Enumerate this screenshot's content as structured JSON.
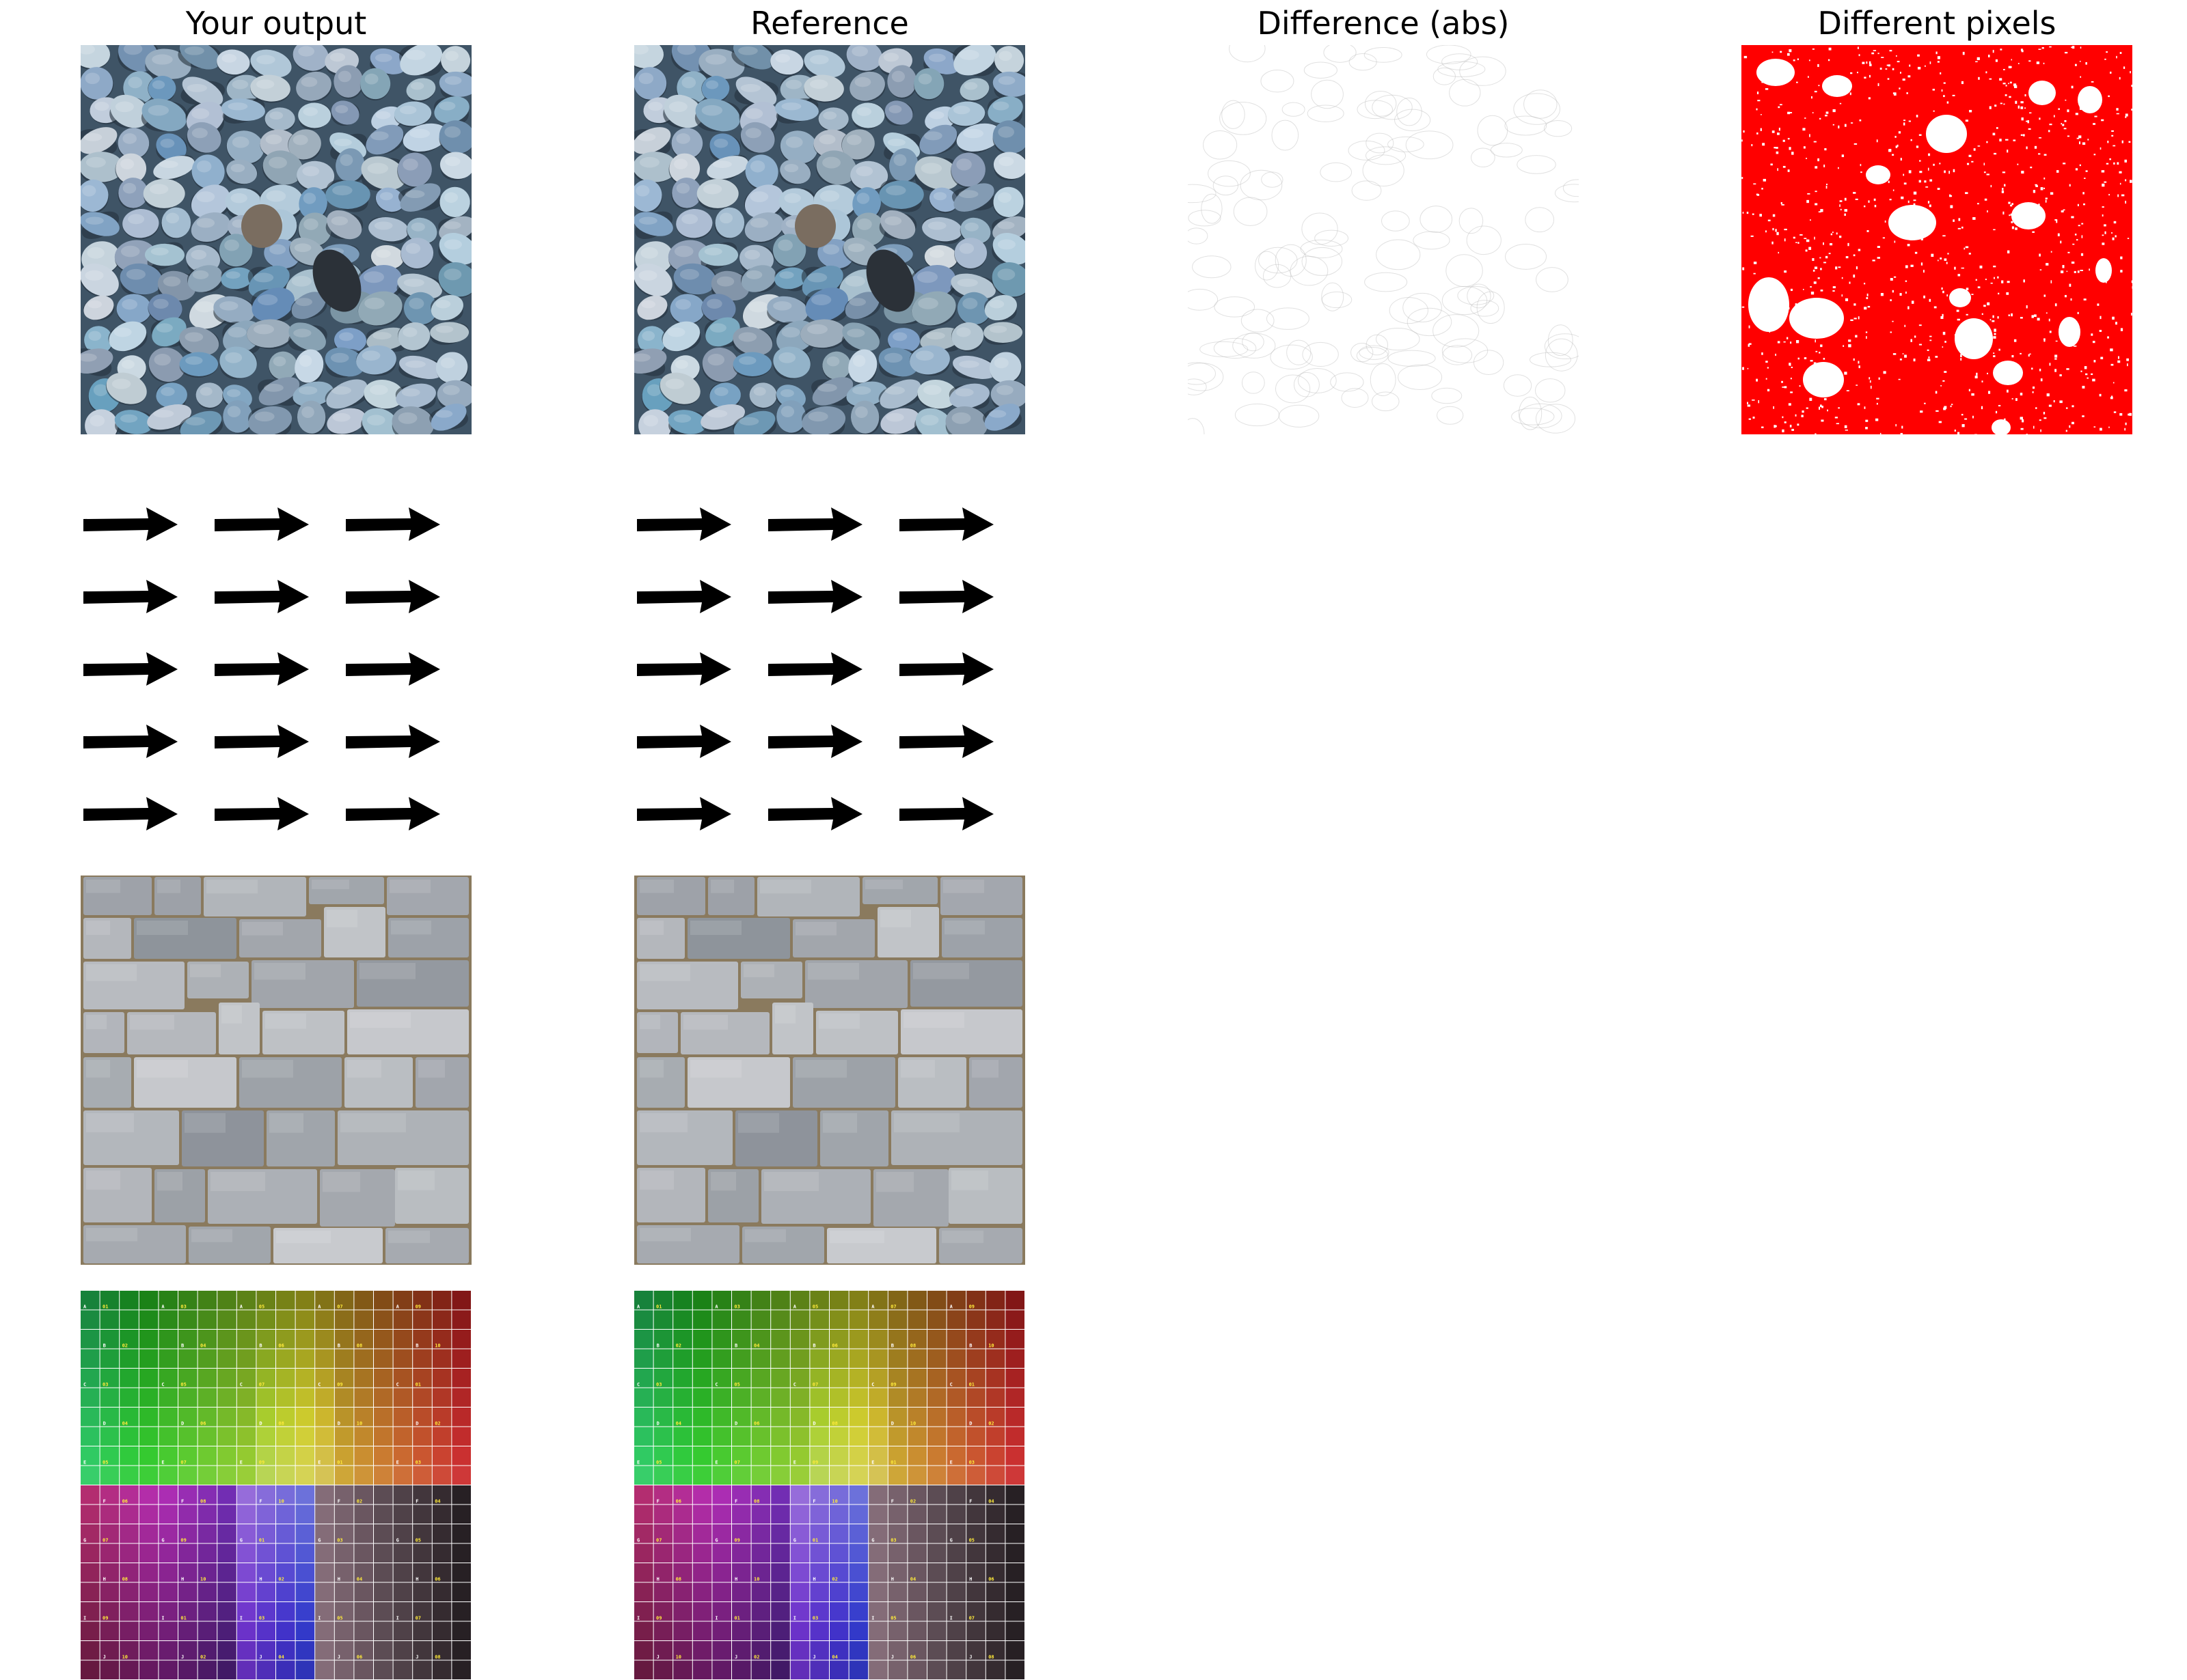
{
  "columns": {
    "output": "Your output",
    "reference": "Reference",
    "difference": "Difference (abs)",
    "different_pixels": "Different pixels"
  },
  "rows": [
    {
      "name": "blue-pebble-texture"
    },
    {
      "name": "arrow-grid"
    },
    {
      "name": "gray-stone-wall-texture"
    },
    {
      "name": "color-checker-grid"
    }
  ],
  "color_grid": {
    "row_letters": [
      "A",
      "B",
      "C",
      "D",
      "E",
      "F",
      "G",
      "H",
      "I",
      "J"
    ],
    "column_numbers": [
      "01",
      "02",
      "03",
      "04",
      "05",
      "06",
      "07",
      "08",
      "09",
      "10"
    ]
  },
  "colors": {
    "diff_marker": "#ff0000",
    "pebble_base": "#7c97ad",
    "stone_base": "#9a9ea4",
    "mortar": "#8a7a5e"
  }
}
